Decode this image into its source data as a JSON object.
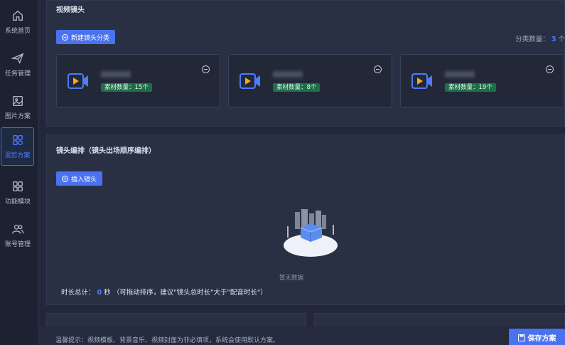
{
  "sidebar": {
    "items": [
      {
        "label": "系统首页",
        "icon": "home-icon"
      },
      {
        "label": "任务管理",
        "icon": "paper-plane-icon"
      },
      {
        "label": "图片方案",
        "icon": "image-icon"
      },
      {
        "label": "混剪方案",
        "icon": "grid-icon",
        "active": true
      },
      {
        "label": "功能模块",
        "icon": "modules-icon"
      },
      {
        "label": "账号管理",
        "icon": "users-icon"
      }
    ]
  },
  "video_shots": {
    "title": "视频镜头",
    "new_category_label": "新建镜头分类",
    "count_label": "分类数量：",
    "count_value": "3",
    "count_unit": "个",
    "cards": [
      {
        "badge": "素材数量：15个"
      },
      {
        "badge": "素材数量：8个"
      },
      {
        "badge": "素材数量：19个"
      }
    ]
  },
  "shot_arrange": {
    "title": "镜头编排（镜头出场顺序编排）",
    "insert_label": "插入镜头",
    "empty_text": "暂无数据",
    "duration_label": "时长总计：",
    "duration_value": "0",
    "duration_unit": "秒",
    "duration_note": "（可拖动排序，建议\"镜头总时长\"大于\"配音时长\"）"
  },
  "footer": {
    "tip": "温馨提示：视频模板、背景音乐、视频封面为非必填项，系统会使用默认方案。",
    "save_label": "保存方案"
  },
  "colors": {
    "accent": "#4a72ef",
    "badge": "#1f6e4a",
    "camera_orange": "#f5a623"
  }
}
